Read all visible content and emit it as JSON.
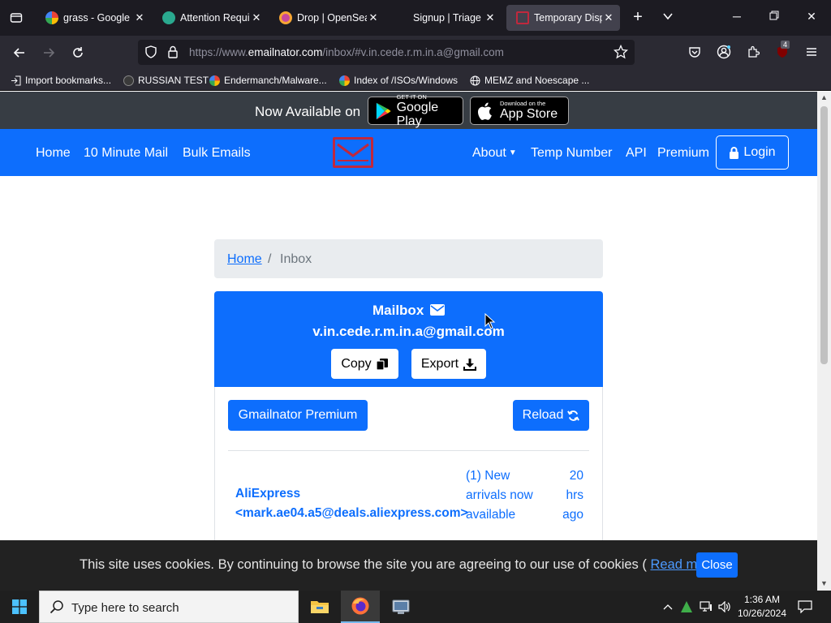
{
  "browser": {
    "tabs": [
      {
        "title": "grass - Google S",
        "icon": "google-icon",
        "active": false
      },
      {
        "title": "Attention Requi",
        "icon": "cloudflare-icon",
        "active": false
      },
      {
        "title": "Drop | OpenSea",
        "icon": "opensea-icon",
        "active": false
      },
      {
        "title": "Signup | Triage",
        "icon": "triage-icon",
        "active": false
      },
      {
        "title": "Temporary Dispo",
        "icon": "emailnator-icon",
        "active": true
      }
    ],
    "url_prefix": "https://www.",
    "url_domain": "emailnator.com",
    "url_suffix": "/inbox/#v.in.cede.r.m.in.a@gmail.com",
    "extension_badge": "4",
    "bookmarks": [
      {
        "label": "Import bookmarks...",
        "icon": "import-icon"
      },
      {
        "label": "RUSSIAN TEST",
        "icon": "github-icon"
      },
      {
        "label": "Endermanch/Malware...",
        "icon": "google-icon"
      },
      {
        "label": "Index of /ISOs/Windows",
        "icon": "google-icon"
      },
      {
        "label": "MEMZ and Noescape ...",
        "icon": "globe-icon"
      }
    ]
  },
  "promo": {
    "text": "Now Available on",
    "google_small": "GET IT ON",
    "google_big": "Google Play",
    "apple_small": "Download on the",
    "apple_big": "App Store"
  },
  "nav": {
    "home": "Home",
    "ten_minute": "10 Minute Mail",
    "bulk": "Bulk Emails",
    "about": "About",
    "temp_number": "Temp Number",
    "api": "API",
    "premium": "Premium",
    "login": "Login"
  },
  "breadcrumb": {
    "home": "Home",
    "separator": "/",
    "current": "Inbox"
  },
  "mailbox": {
    "title": "Mailbox",
    "address": "v.in.cede.r.m.in.a@gmail.com",
    "copy": "Copy",
    "export": "Export"
  },
  "actions": {
    "premium": "Gmailnator Premium",
    "reload": "Reload"
  },
  "messages": [
    {
      "from_name": "AliExpress",
      "from_email": "<mark.ae04.a5@deals.aliexpress.com>",
      "subject_lines": [
        "(1) New",
        "arrivals now",
        "available"
      ],
      "time_lines": [
        "20",
        "hrs",
        "ago"
      ]
    }
  ],
  "cookie": {
    "text": "This site uses cookies. By continuing to browse the site you are agreeing to our use of cookies (",
    "link": "Read more",
    "close_paren": ")",
    "button": "Close"
  },
  "taskbar": {
    "search_placeholder": "Type here to search",
    "time": "1:36 AM",
    "date": "10/26/2024"
  },
  "colors": {
    "brand_blue": "#0d6efd",
    "promo_bg": "#373d44",
    "logo_red": "#c0283d",
    "tabbar_bg": "#1c1b22",
    "toolbar_bg": "#2b2a33"
  }
}
